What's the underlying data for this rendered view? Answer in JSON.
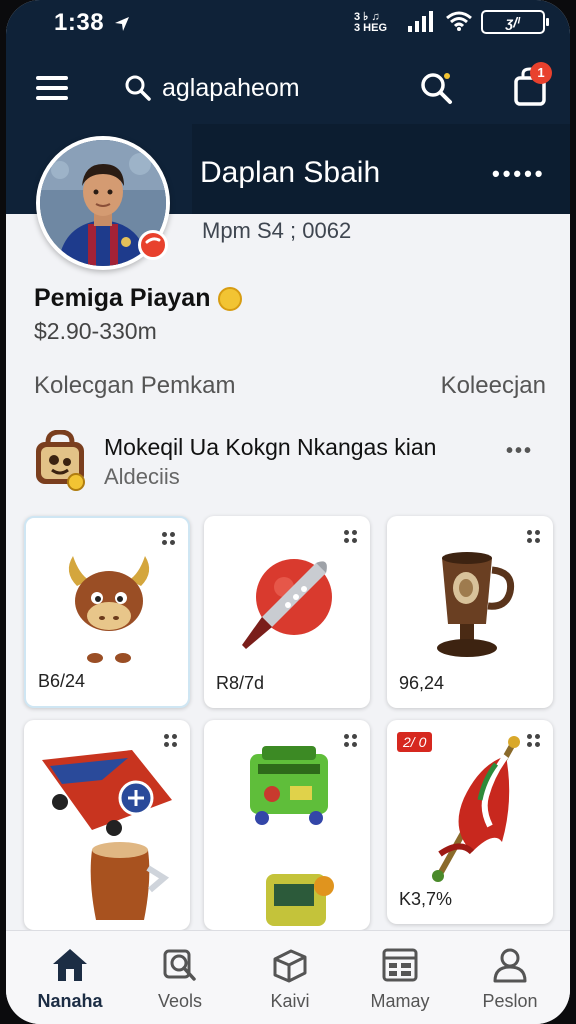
{
  "status_bar": {
    "time": "1:38",
    "signal_text_top": "3 ♭ ♫",
    "signal_text_bottom": "3 HEG",
    "battery_label": "ʒ/ᴵ"
  },
  "header": {
    "search_text": "aglapaheom",
    "notification_count": "1"
  },
  "profile": {
    "name": "Daplan Sbaih",
    "more": "•••••",
    "member_info": "Mpm S4 ; 0062",
    "player_title": "Pemiga Piayan",
    "balance": "$2.90-330m"
  },
  "collections": {
    "left_label": "Kolecgan Pemkam",
    "right_label": "Koleecjan"
  },
  "pack": {
    "title": "Mokeqil Ua Kokgn Nkangas kian",
    "subtitle": "Aldeciis",
    "more": "•••"
  },
  "items": [
    {
      "name": "bull-mascot",
      "price": "B6/24",
      "tag": ""
    },
    {
      "name": "rocket-ball",
      "price": "R8/7d",
      "tag": ""
    },
    {
      "name": "bronze-cup",
      "price": "96,24",
      "tag": ""
    },
    {
      "name": "race-car",
      "price": "",
      "tag": ""
    },
    {
      "name": "green-console",
      "price": "",
      "tag": ""
    },
    {
      "name": "red-flag",
      "price": "K3,7%",
      "tag": "2/ 0"
    }
  ],
  "tabs": [
    {
      "label": "Nanaha",
      "icon": "home-icon"
    },
    {
      "label": "Veols",
      "icon": "search-card-icon"
    },
    {
      "label": "Kaivi",
      "icon": "box-icon"
    },
    {
      "label": "Mamay",
      "icon": "list-icon"
    },
    {
      "label": "Peslon",
      "icon": "person-icon"
    }
  ],
  "colors": {
    "header_bg": "#0f2238",
    "accent_red": "#e8412d",
    "coin_gold": "#f2c433",
    "page_bg": "#f2f3f6"
  }
}
